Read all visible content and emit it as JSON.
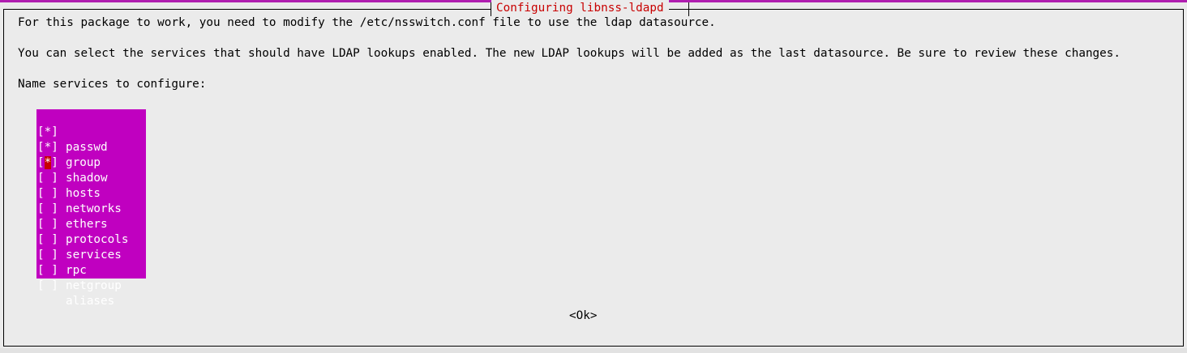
{
  "dialog": {
    "title": "Configuring libnss-ldapd",
    "paragraph1": "For this package to work, you need to modify the /etc/nsswitch.conf file to use the ldap datasource.",
    "paragraph2": "You can select the services that should have LDAP lookups enabled. The new LDAP lookups will be added as the last datasource. Be sure to review these changes.",
    "prompt": "Name services to configure:",
    "items": [
      {
        "name": "passwd",
        "checked": true,
        "mark": "*"
      },
      {
        "name": "group",
        "checked": true,
        "mark": "*"
      },
      {
        "name": "shadow",
        "checked": true,
        "mark": "*",
        "cursor": true
      },
      {
        "name": "hosts",
        "checked": false,
        "mark": " "
      },
      {
        "name": "networks",
        "checked": false,
        "mark": " "
      },
      {
        "name": "ethers",
        "checked": false,
        "mark": " "
      },
      {
        "name": "protocols",
        "checked": false,
        "mark": " "
      },
      {
        "name": "services",
        "checked": false,
        "mark": " "
      },
      {
        "name": "rpc",
        "checked": false,
        "mark": " "
      },
      {
        "name": "netgroup",
        "checked": false,
        "mark": " "
      },
      {
        "name": "aliases",
        "checked": false,
        "mark": " "
      }
    ],
    "ok_label": "<Ok>"
  },
  "colors": {
    "background": "#ebebeb",
    "title_text": "#c80000",
    "list_highlight": "#c000c0",
    "cursor": "#c80000",
    "top_strip": "#b01eb0"
  }
}
